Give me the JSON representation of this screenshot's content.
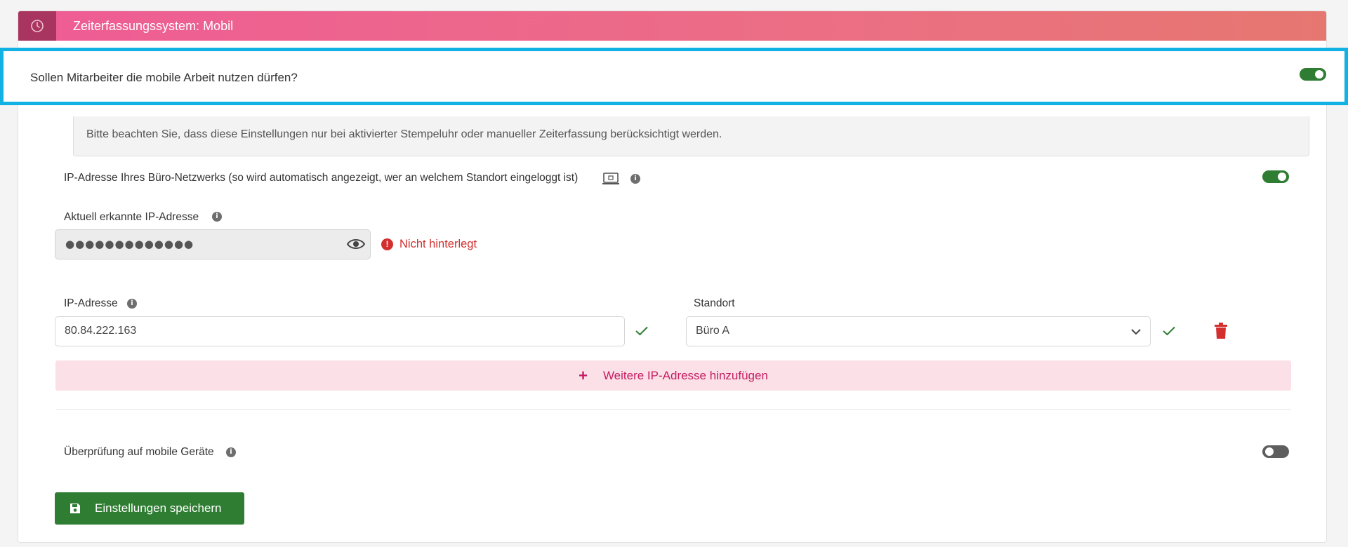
{
  "panel": {
    "title": "Zeiterfassungssystem: Mobil",
    "header_icon": "clock-icon",
    "gradient_colors": [
      "#ee5c95",
      "#e67770"
    ]
  },
  "mobile_work": {
    "question": "Sollen Mitarbeiter die mobile Arbeit nutzen dürfen?",
    "enabled": true
  },
  "note": "Bitte beachten Sie, dass diese Einstellungen nur bei aktivierter Stempeluhr oder manueller Zeiterfassung berücksichtigt werden.",
  "office_network": {
    "label": "IP-Adresse Ihres Büro-Netzwerks (so wird automatisch angezeigt, wer an welchem Standort eingeloggt ist)",
    "icon": "monitor-icon",
    "enabled": true
  },
  "detected_ip": {
    "label": "Aktuell erkannte IP-Adresse",
    "masked_value": "●●●●●●●●●●●●●",
    "status": "Nicht hinterlegt"
  },
  "ip_entry": {
    "ip_label": "IP-Adresse",
    "ip_value": "80.84.222.163",
    "location_label": "Standort",
    "location_value": "Büro A"
  },
  "add_ip_button": "Weitere IP-Adresse hinzufügen",
  "mobile_device_check": {
    "label": "Überprüfung auf mobile Geräte",
    "enabled": false
  },
  "save_button": "Einstellungen speichern",
  "colors": {
    "accent_green": "#2e7d32",
    "highlight_border": "#12b1e4",
    "error_red": "#d32f2f",
    "pink_text": "#c51d62"
  }
}
